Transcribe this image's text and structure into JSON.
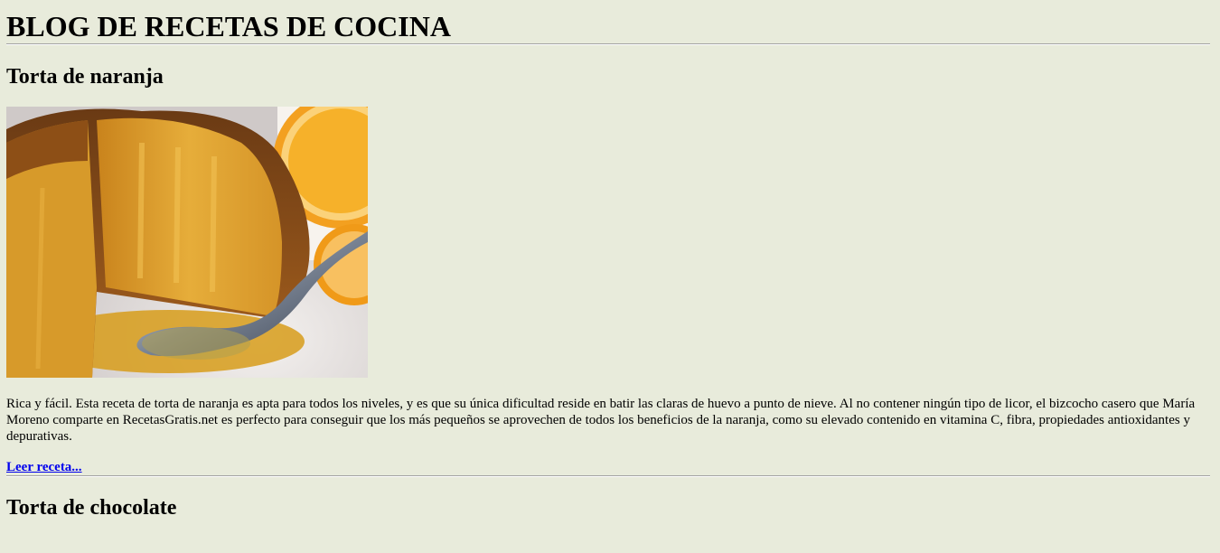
{
  "site": {
    "title": "BLOG DE RECETAS DE COCINA"
  },
  "posts": [
    {
      "title": "Torta de naranja",
      "image_alt": "Torta de naranja con cuchara",
      "body": "Rica y fácil. Esta receta de torta de naranja es apta para todos los niveles, y es que su única dificultad reside en batir las claras de huevo a punto de nieve. Al no contener ningún tipo de licor, el bizcocho casero que María Moreno comparte en RecetasGratis.net es perfecto para conseguir que los más pequeños se aprovechen de todos los beneficios de la naranja, como su elevado contenido en vitamina C, fibra, propiedades antioxidantes y depurativas.",
      "link_label": "Leer receta..."
    },
    {
      "title": "Torta de chocolate"
    }
  ],
  "colors": {
    "background": "#e8ebdb",
    "link": "#0000ee"
  }
}
